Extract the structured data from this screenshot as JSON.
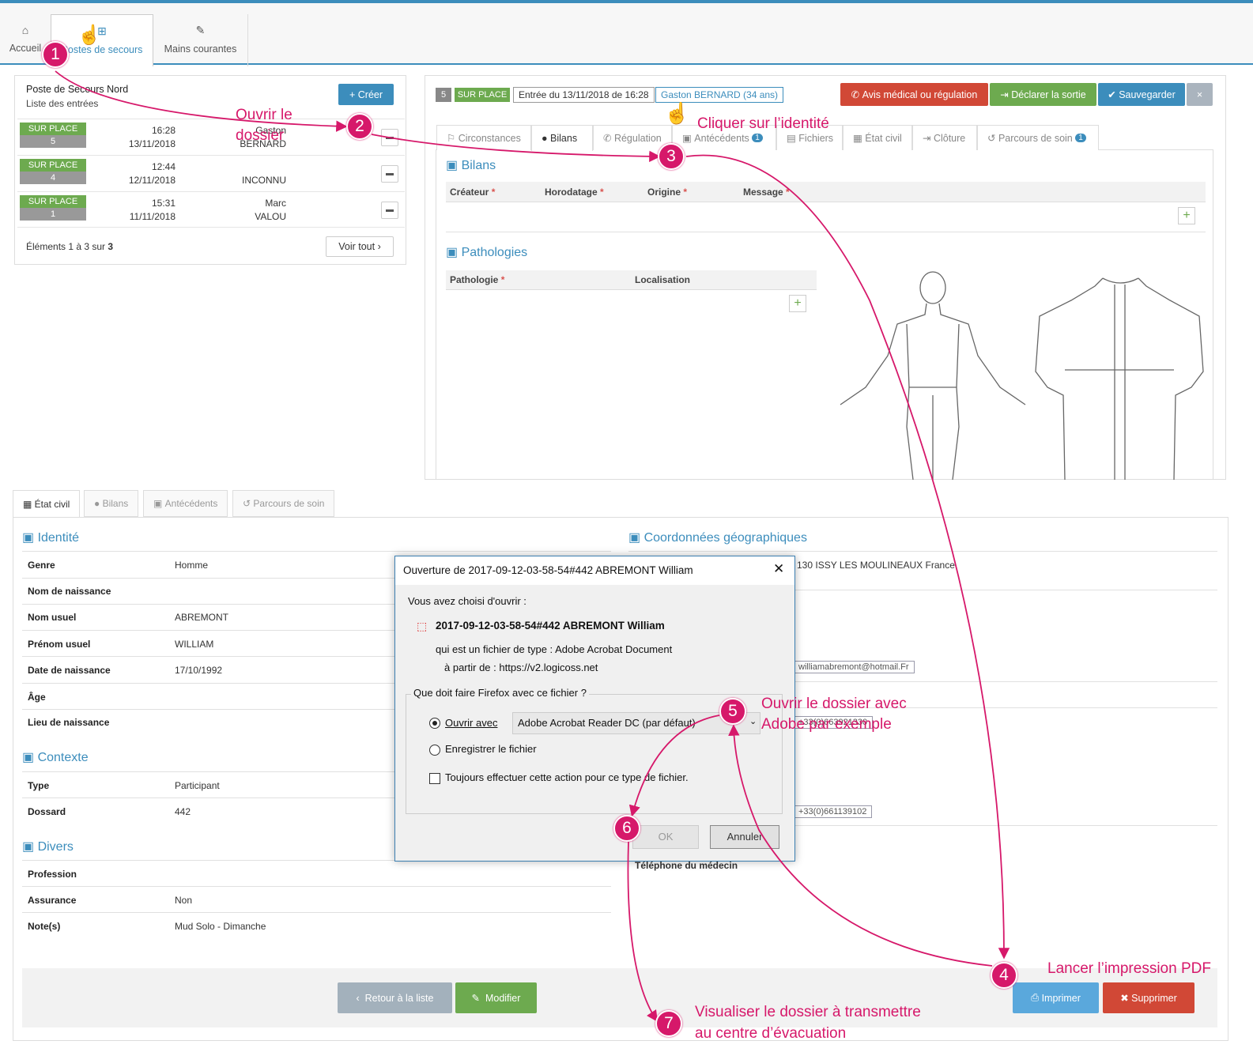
{
  "nav": {
    "tabs": [
      {
        "label": "Accueil"
      },
      {
        "label": "Postes de secours"
      },
      {
        "label": "Mains courantes"
      }
    ]
  },
  "left_panel": {
    "title": "Poste de Secours Nord",
    "subtitle": "Liste des entrées",
    "create_label": "Créer",
    "rows": [
      {
        "status": "SUR PLACE",
        "num": "5",
        "time": "16:28",
        "date": "13/11/2018",
        "first": "Gaston",
        "last": "BERNARD"
      },
      {
        "status": "SUR PLACE",
        "num": "4",
        "time": "12:44",
        "date": "12/11/2018",
        "first": "",
        "last": "INCONNU"
      },
      {
        "status": "SUR PLACE",
        "num": "1",
        "time": "15:31",
        "date": "11/11/2018",
        "first": "Marc",
        "last": "VALOU"
      }
    ],
    "footer_prefix": "Éléments 1 à 3 sur",
    "footer_count": "3",
    "see_all": "Voir tout"
  },
  "header": {
    "num": "5",
    "status": "SUR PLACE",
    "entry": "Entrée du 13/11/2018 de 16:28",
    "identity": "Gaston BERNARD (34 ans)",
    "btn_medical": "Avis médical ou régulation",
    "btn_exit": "Déclarer la sortie",
    "btn_save": "Sauvegarder",
    "btn_close": "×"
  },
  "tabs2": [
    "Circonstances",
    "Bilans",
    "Régulation",
    "Antécédents",
    "Fichiers",
    "État civil",
    "Clôture",
    "Parcours de soin"
  ],
  "tab_badges": {
    "antecedents": "1",
    "parcours": "1"
  },
  "bilans": {
    "title": "Bilans",
    "cols": [
      "Créateur",
      "Horodatage",
      "Origine",
      "Message"
    ]
  },
  "patho": {
    "title": "Pathologies",
    "cols": [
      "Pathologie",
      "Localisation"
    ]
  },
  "bottom_tabs": [
    "État civil",
    "Bilans",
    "Antécédents",
    "Parcours de soin"
  ],
  "identite": {
    "title": "Identité",
    "fields": [
      {
        "label": "Genre",
        "value": "Homme"
      },
      {
        "label": "Nom de naissance",
        "value": ""
      },
      {
        "label": "Nom usuel",
        "value": "ABREMONT"
      },
      {
        "label": "Prénom usuel",
        "value": "WILLIAM"
      },
      {
        "label": "Date de naissance",
        "value": "17/10/1992"
      },
      {
        "label": "Âge",
        "value": ""
      },
      {
        "label": "Lieu de naissance",
        "value": ""
      }
    ]
  },
  "contexte": {
    "title": "Contexte",
    "fields": [
      {
        "label": "Type",
        "value": "Participant"
      },
      {
        "label": "Dossard",
        "value": "442"
      }
    ]
  },
  "divers": {
    "title": "Divers",
    "fields": [
      {
        "label": "Profession",
        "value": ""
      },
      {
        "label": "Assurance",
        "value": "Non"
      },
      {
        "label": "Note(s)",
        "value": "Mud Solo - Dimanche"
      }
    ]
  },
  "coords": {
    "title": "Coordonnées géographiques",
    "address": "130 ISSY LES MOULINEAUX France",
    "email": "williamabremont@hotmail.Fr",
    "phone1": "+33(0)663921330",
    "phone2": "+33(0)661139102",
    "doctor_phone_label": "Téléphone du médecin"
  },
  "footer_buttons": {
    "back": "Retour à la liste",
    "edit": "Modifier",
    "print": "Imprimer",
    "delete": "Supprimer"
  },
  "dialog": {
    "title": "Ouverture de 2017-09-12-03-58-54#442 ABREMONT William",
    "chosen": "Vous avez choisi d'ouvrir :",
    "filename": "2017-09-12-03-58-54#442 ABREMONT William",
    "type_label": "qui est un fichier de type :",
    "type_value": "Adobe Acrobat Document",
    "from_label": "à partir de :",
    "from_value": "https://v2.logicoss.net",
    "question": "Que doit faire Firefox avec ce fichier ?",
    "open_with": "Ouvrir avec",
    "app": "Adobe Acrobat Reader DC  (par défaut)",
    "save": "Enregistrer le fichier",
    "always": "Toujours effectuer cette action pour ce type de fichier.",
    "ok": "OK",
    "cancel": "Annuler"
  },
  "annotations": {
    "s1": "1",
    "s2": "2",
    "s3": "3",
    "s4": "4",
    "s5": "5",
    "s6": "6",
    "s7": "7",
    "a2": "Ouvrir le dossier",
    "a3": "Cliquer sur l’identité",
    "a4": "Lancer l’impression PDF",
    "a5": "Ouvrir le dossier avec Adobe par exemple",
    "a7a": "Visualiser le dossier à transmettre",
    "a7b": "au centre d’évacuation"
  },
  "colors": {
    "accent": "#3c8dbc",
    "green": "#6daa4f",
    "red": "#d14836",
    "magenta": "#d6186a"
  }
}
